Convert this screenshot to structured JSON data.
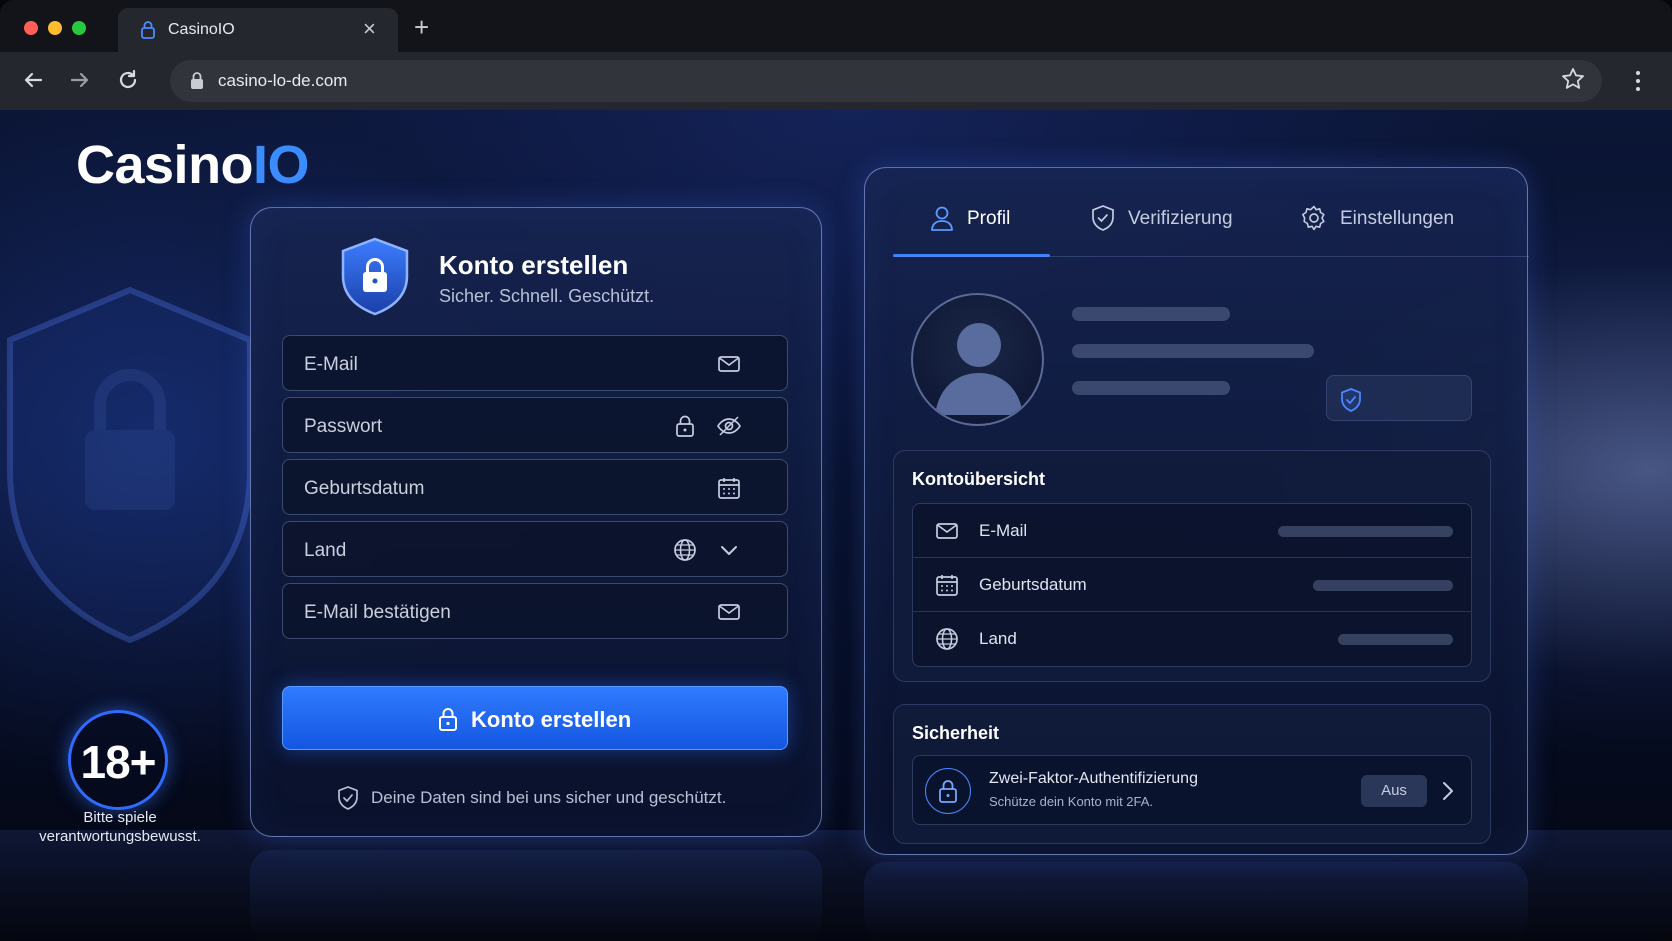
{
  "browser": {
    "tab_title": "CasinoIO",
    "url": "casino-lo-de.com",
    "close_glyph": "×",
    "new_tab_glyph": "+"
  },
  "brand": {
    "logo_main": "Casino",
    "logo_accent": "IO",
    "accent_color": "#3b8cff"
  },
  "age_badge": {
    "label": "18+",
    "message": "Bitte spiele verantwortungsbewusst."
  },
  "signup": {
    "title": "Konto erstellen",
    "subtitle": "Sicher. Schnell. Geschützt.",
    "fields": {
      "email": "E-Mail",
      "password": "Passwort",
      "birthdate": "Geburtsdatum",
      "country": "Land",
      "email_confirm": "E-Mail bestätigen"
    },
    "submit_label": "Konto erstellen",
    "secure_note": "Deine Daten sind bei uns sicher und geschützt."
  },
  "profile_panel": {
    "tabs": [
      "Profil",
      "Verifizierung",
      "Einstellungen"
    ],
    "active_tab": "Profil",
    "overview": {
      "title": "Kontoübersicht",
      "rows": [
        "E-Mail",
        "Geburtsdatum",
        "Land"
      ]
    },
    "security": {
      "title": "Sicherheit",
      "twofa_title": "Zwei-Faktor-Authentifizierung",
      "twofa_sub": "Schütze dein Konto mit 2FA.",
      "twofa_state": "Aus"
    }
  },
  "icons": {
    "tab": "lock-icon",
    "url": "lock-icon",
    "fields": [
      "mail-icon",
      "lock-icon",
      "eye-icon",
      "calendar-icon",
      "globe-icon",
      "chevron-down-icon",
      "mail-icon"
    ],
    "tabs": [
      "user-icon",
      "shield-check-icon",
      "gear-icon"
    ]
  },
  "colors": {
    "primary_button": "#1f66f0",
    "active_tab_underline": "#3b82ff"
  }
}
